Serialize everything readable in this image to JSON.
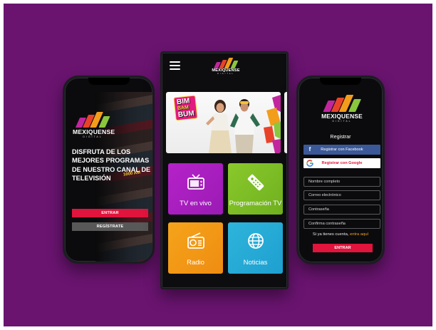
{
  "brand": {
    "name": "MEXIQUENSE",
    "sub": "DIGITAL",
    "logo_colors": [
      "#c1269e",
      "#e8432a",
      "#f29d1b",
      "#8bc63f"
    ]
  },
  "left_phone": {
    "headline": "DISFRUTA DE LOS MEJORES PROGRAMAS DE NUESTRO CANAL DE TELEVISIÓN",
    "enter_label": "ENTRAR",
    "register_label": "REGÍSTRATE",
    "background_text": "1000 AM"
  },
  "center_phone": {
    "banner": {
      "title_top": "BIM",
      "title_mid": "BAM",
      "title_bot": "BUM"
    },
    "tiles": [
      {
        "label": "TV en vivo",
        "icon": "tv-icon",
        "color": "#b522c9"
      },
      {
        "label": "Programación TV",
        "icon": "remote-icon",
        "color": "#8ac92b"
      },
      {
        "label": "Radio",
        "icon": "radio-icon",
        "color": "#f5a41a"
      },
      {
        "label": "Noticias",
        "icon": "globe-icon",
        "color": "#2eb5db"
      }
    ]
  },
  "right_phone": {
    "title": "Registrar",
    "facebook_label": "Registrar con Facebook",
    "google_label": "Registrar con Google",
    "fields": {
      "name_placeholder": "Nombre completo",
      "email_placeholder": "Correo electrónico",
      "password_placeholder": "Contraseña",
      "confirm_placeholder": "Confirma contraseña"
    },
    "have_account": "Si ya tienes cuenta,",
    "login_link": "entra aquí",
    "enter_label": "ENTRAR"
  },
  "colors": {
    "background": "#6a1470",
    "accent_red": "#e0143c",
    "link_orange": "#f4a21c",
    "facebook_blue": "#3b5998"
  }
}
